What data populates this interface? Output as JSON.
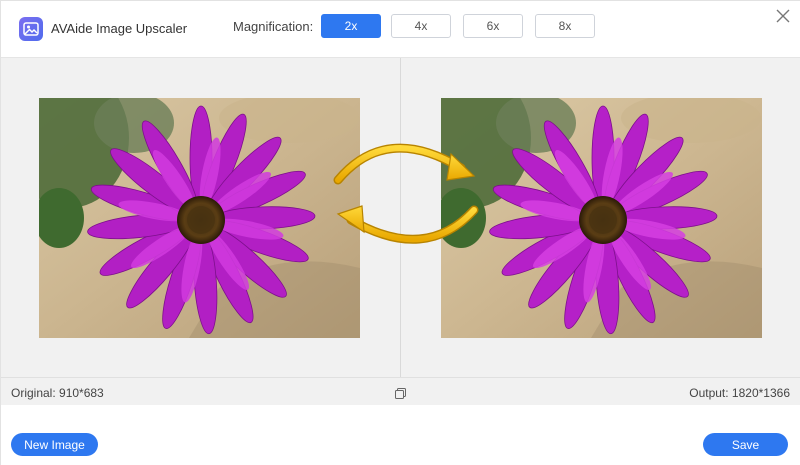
{
  "app": {
    "title": "AVAide Image Upscaler",
    "logo_icon": "image-icon"
  },
  "magnification": {
    "label": "Magnification:",
    "options": [
      "2x",
      "4x",
      "6x",
      "8x"
    ],
    "selected": "2x"
  },
  "info": {
    "original": "Original: 910*683",
    "output": "Output: 1820*1366"
  },
  "footer": {
    "new_image_label": "New Image",
    "save_label": "Save"
  },
  "colors": {
    "accent": "#2e78f0",
    "flower": "#b21fc4",
    "arrow": "#f4c21a"
  }
}
